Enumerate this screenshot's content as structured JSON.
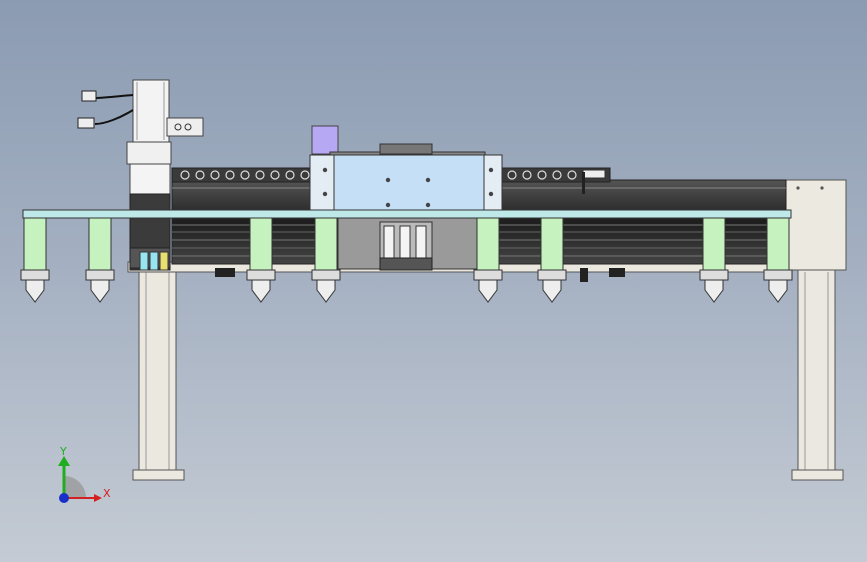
{
  "viewport": {
    "background_top": "#8b9bb2",
    "background_bottom": "#c4cbd4"
  },
  "model": {
    "frame_color": "#e9e6dc",
    "rail_color": "#2c2c2c",
    "carriage_color": "#c5e0f6",
    "nozzle_guard_color": "#c6f2bf",
    "glass_bar_color": "#bfe8e8",
    "motor_color": "#f2f2f2",
    "accent_purple": "#b7a8f3",
    "nozzle_count": 8
  },
  "triad": {
    "y_label": "Y",
    "x_label": "X",
    "y_color": "#1fae1f",
    "x_color": "#d42020",
    "z_color": "#1830c8"
  }
}
